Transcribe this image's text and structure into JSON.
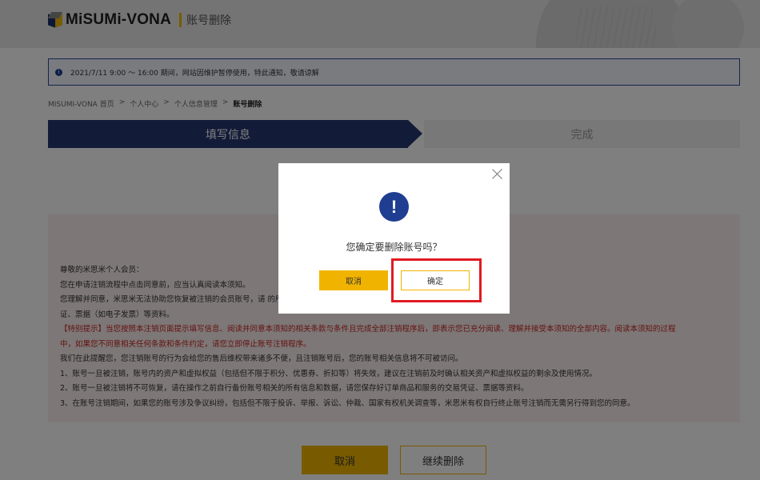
{
  "header": {
    "logo_text": "MiSUMi-VONA",
    "page_label": "账号删除"
  },
  "notice": {
    "text": "2021/7/11 9:00 ～ 16:00 期间，网站因维护暂停使用，特此通知，敬请谅解"
  },
  "breadcrumb": {
    "items": [
      "MISUMI-VONA 首页",
      "个人中心",
      "个人信息管理"
    ],
    "separator": ">",
    "current": "账号删除"
  },
  "steps": {
    "step1": "填写信息",
    "step2": "完成"
  },
  "content": {
    "lines": [
      "尊敬的米思米个人会员：",
      "您在申请注销流程中点击同意前，应当认真阅读本须知。",
      "您理解并同意，米思米无法协助您恢复被注销的会员账号，请                                                                                                          的所有信息和数据，下载并保存好订单商品和服务的交易凭",
      "证、票据（如电子发票）等资料。",
      "【特别提示】当您按照本注销页面提示填写信息、阅读并同意本须知的相关条款与条件且完成全部注销程序后，即表示您已充分阅读、理解并接受本须知的全部内容。阅读本须知的过程",
      "中，如果您不同意相关任何条款和条件约定，请您立即停止账号注销程序。",
      "我们在此提醒您，您注销账号的行为会给您的售后维权带来诸多不便，且注销账号后，您的账号相关信息将不可被访问。",
      "1、账号一旦被注销，账号内的资产和虚拟权益（包括但不限于积分、优惠券、折扣等）将失效，建议在注销前及时确认相关资产和虚拟权益的剩余及使用情况。",
      "2、账号一旦被注销将不可恢复，请在操作之前自行备份账号相关的所有信息和数据，请您保存好订单商品和服务的交易凭证、票据等资料。",
      "3、在账号注销期间，如果您的账号涉及争议纠纷，包括但不限于投诉、举报、诉讼、仲裁、国家有权机关调查等，米思米有权自行终止账号注销而无需另行得到您的同意。"
    ]
  },
  "buttons": {
    "cancel": "取消",
    "continue": "继续删除"
  },
  "modal": {
    "icon": "!",
    "message": "您确定要删除账号吗？",
    "cancel": "取消",
    "ok": "确定"
  },
  "colors": {
    "brand_navy": "#243771",
    "brand_yellow": "#f0b400",
    "highlight_red": "#e01a22",
    "warning_red": "#c4261f"
  }
}
